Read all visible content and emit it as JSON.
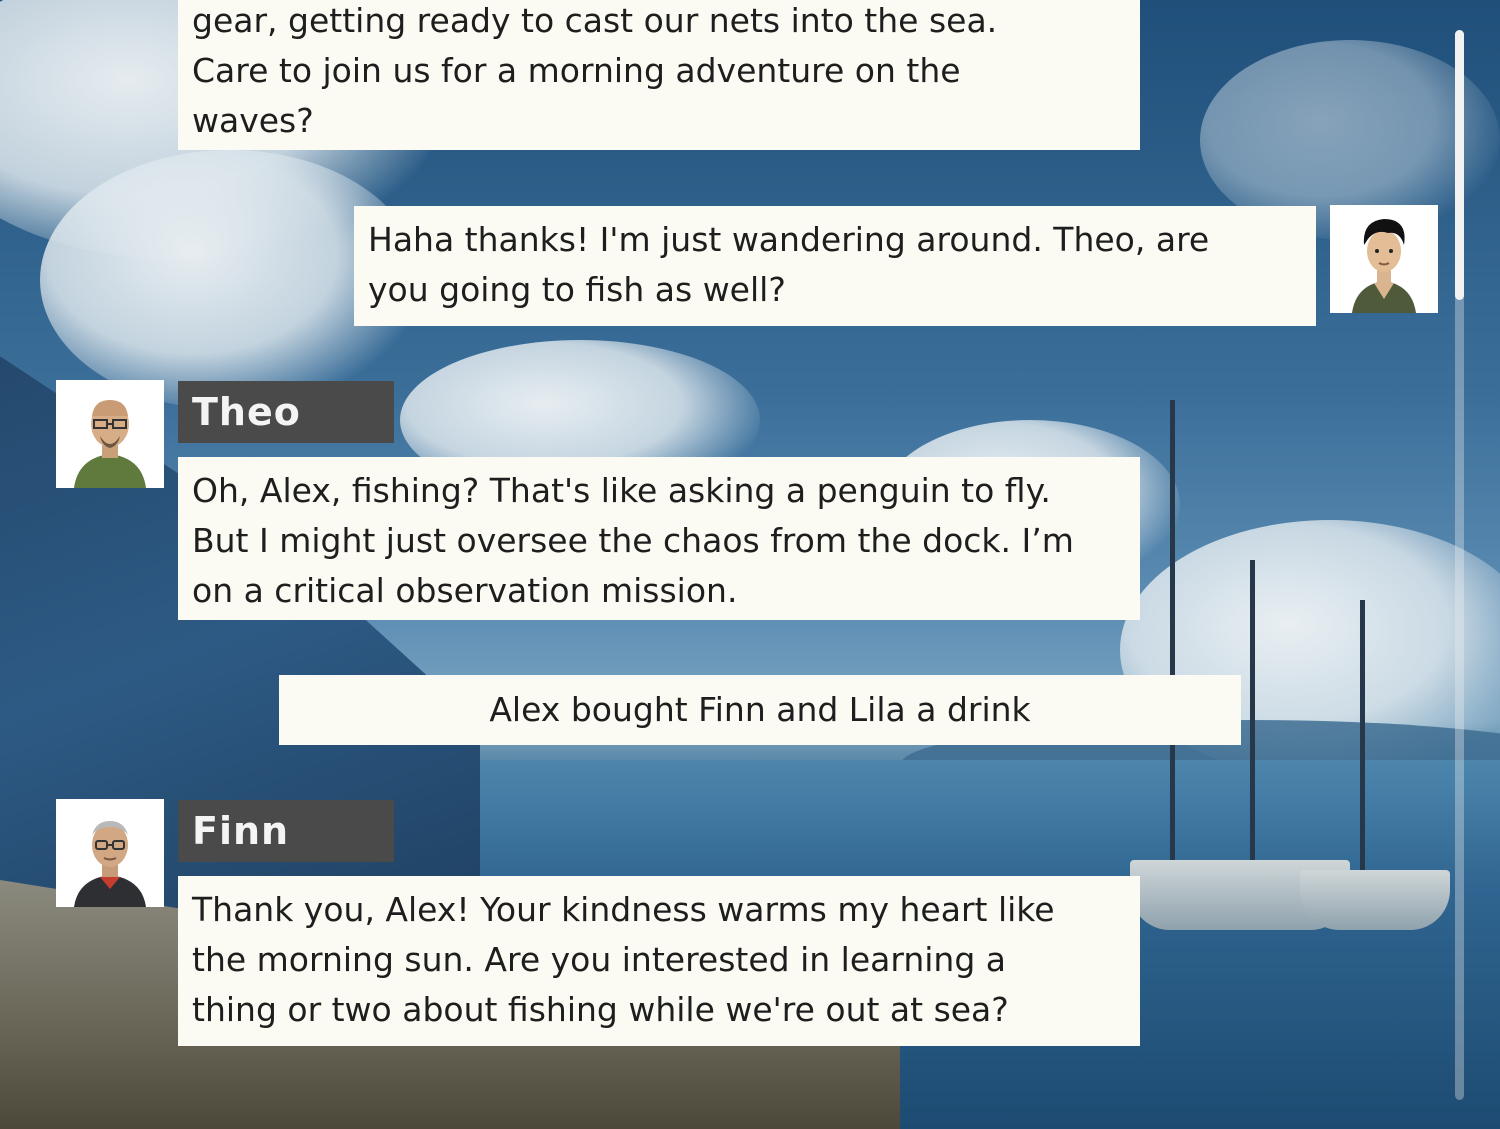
{
  "messages": {
    "prev_npc": {
      "lines": [
        "gear, getting ready to cast our nets into the sea.",
        "Care to join us for a morning adventure on the",
        "waves?"
      ]
    },
    "player": {
      "lines": [
        "Haha thanks! I'm just wandering around. Theo, are",
        "you going to fish as well?"
      ],
      "avatar_icon": "young-man-portrait"
    },
    "theo": {
      "name": "Theo",
      "lines": [
        "Oh, Alex, fishing? That's like asking a penguin to fly.",
        "But I might just oversee the chaos from the dock. I’m",
        "on a critical observation mission."
      ],
      "avatar_icon": "bald-man-goatee-portrait"
    },
    "event": {
      "text": "Alex bought Finn and Lila a drink"
    },
    "finn": {
      "name": "Finn",
      "lines": [
        "Thank you, Alex! Your kindness warms my heart like",
        "the morning sun. Are you interested in learning a",
        "thing or two about fishing while we're out at sea?"
      ],
      "avatar_icon": "elderly-man-glasses-portrait"
    }
  },
  "colors": {
    "bubble_bg": "#fbfbf3",
    "name_tag_bg": "#4a4a4a",
    "text": "#1e1e1e",
    "scene_sky": "#2f5f86"
  }
}
